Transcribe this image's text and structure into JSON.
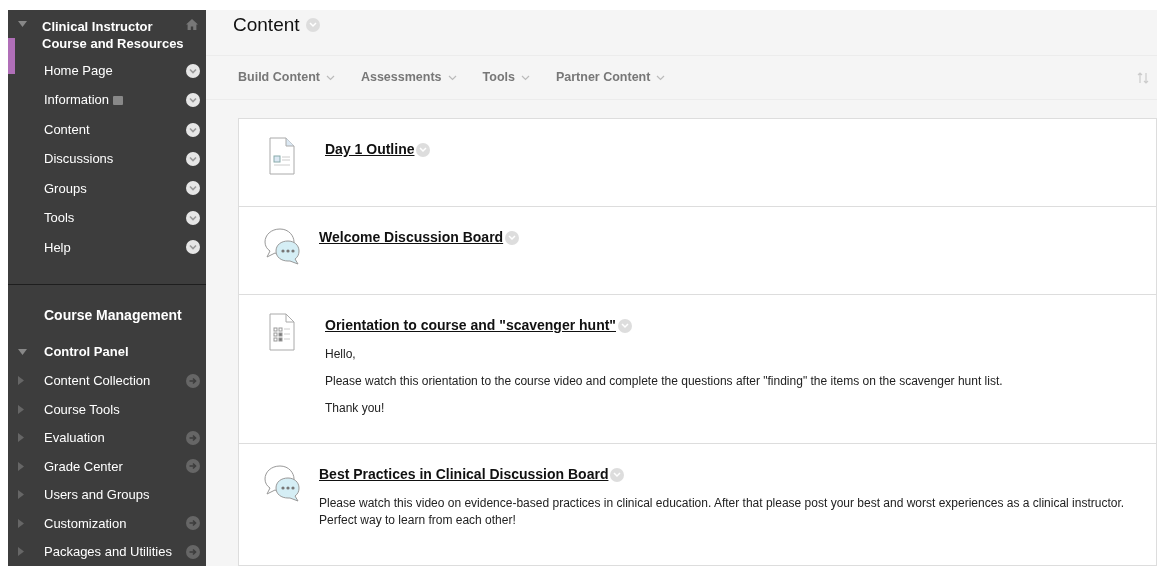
{
  "course_menu": {
    "title": "Clinical Instructor Course and Resources",
    "expanded": true,
    "items": [
      {
        "label": "Home Page",
        "page_icon": false
      },
      {
        "label": "Information",
        "page_icon": true
      },
      {
        "label": "Content",
        "page_icon": false
      },
      {
        "label": "Discussions",
        "page_icon": false
      },
      {
        "label": "Groups",
        "page_icon": false
      },
      {
        "label": "Tools",
        "page_icon": false
      },
      {
        "label": "Help",
        "page_icon": false
      }
    ]
  },
  "course_management": {
    "heading": "Course Management",
    "panel_title": "Control Panel",
    "expanded": true,
    "items": [
      {
        "label": "Content Collection",
        "has_arrow": true
      },
      {
        "label": "Course Tools",
        "has_arrow": false
      },
      {
        "label": "Evaluation",
        "has_arrow": true
      },
      {
        "label": "Grade Center",
        "has_arrow": true
      },
      {
        "label": "Users and Groups",
        "has_arrow": false
      },
      {
        "label": "Customization",
        "has_arrow": true
      },
      {
        "label": "Packages and Utilities",
        "has_arrow": true
      }
    ]
  },
  "page_title": "Content",
  "toolbar": [
    "Build Content",
    "Assessments",
    "Tools",
    "Partner Content"
  ],
  "content_items": [
    {
      "kind": "document",
      "title": "Day 1 Outline"
    },
    {
      "kind": "discussion",
      "title": "Welcome Discussion Board"
    },
    {
      "kind": "checklist",
      "title": "Orientation to course and \"scavenger hunt\"",
      "paragraphs": [
        "Hello,",
        "Please watch this orientation to the course video and complete the questions after \"finding\" the items on the scavenger hunt list.",
        "Thank you!"
      ]
    },
    {
      "kind": "discussion",
      "title": "Best Practices in Clinical Discussion Board",
      "paragraphs": [
        "Please watch this video on evidence-based practices in clinical education. After that please post your best and worst experiences as a clinical instructor. Perfect way to learn from each other!"
      ]
    }
  ]
}
